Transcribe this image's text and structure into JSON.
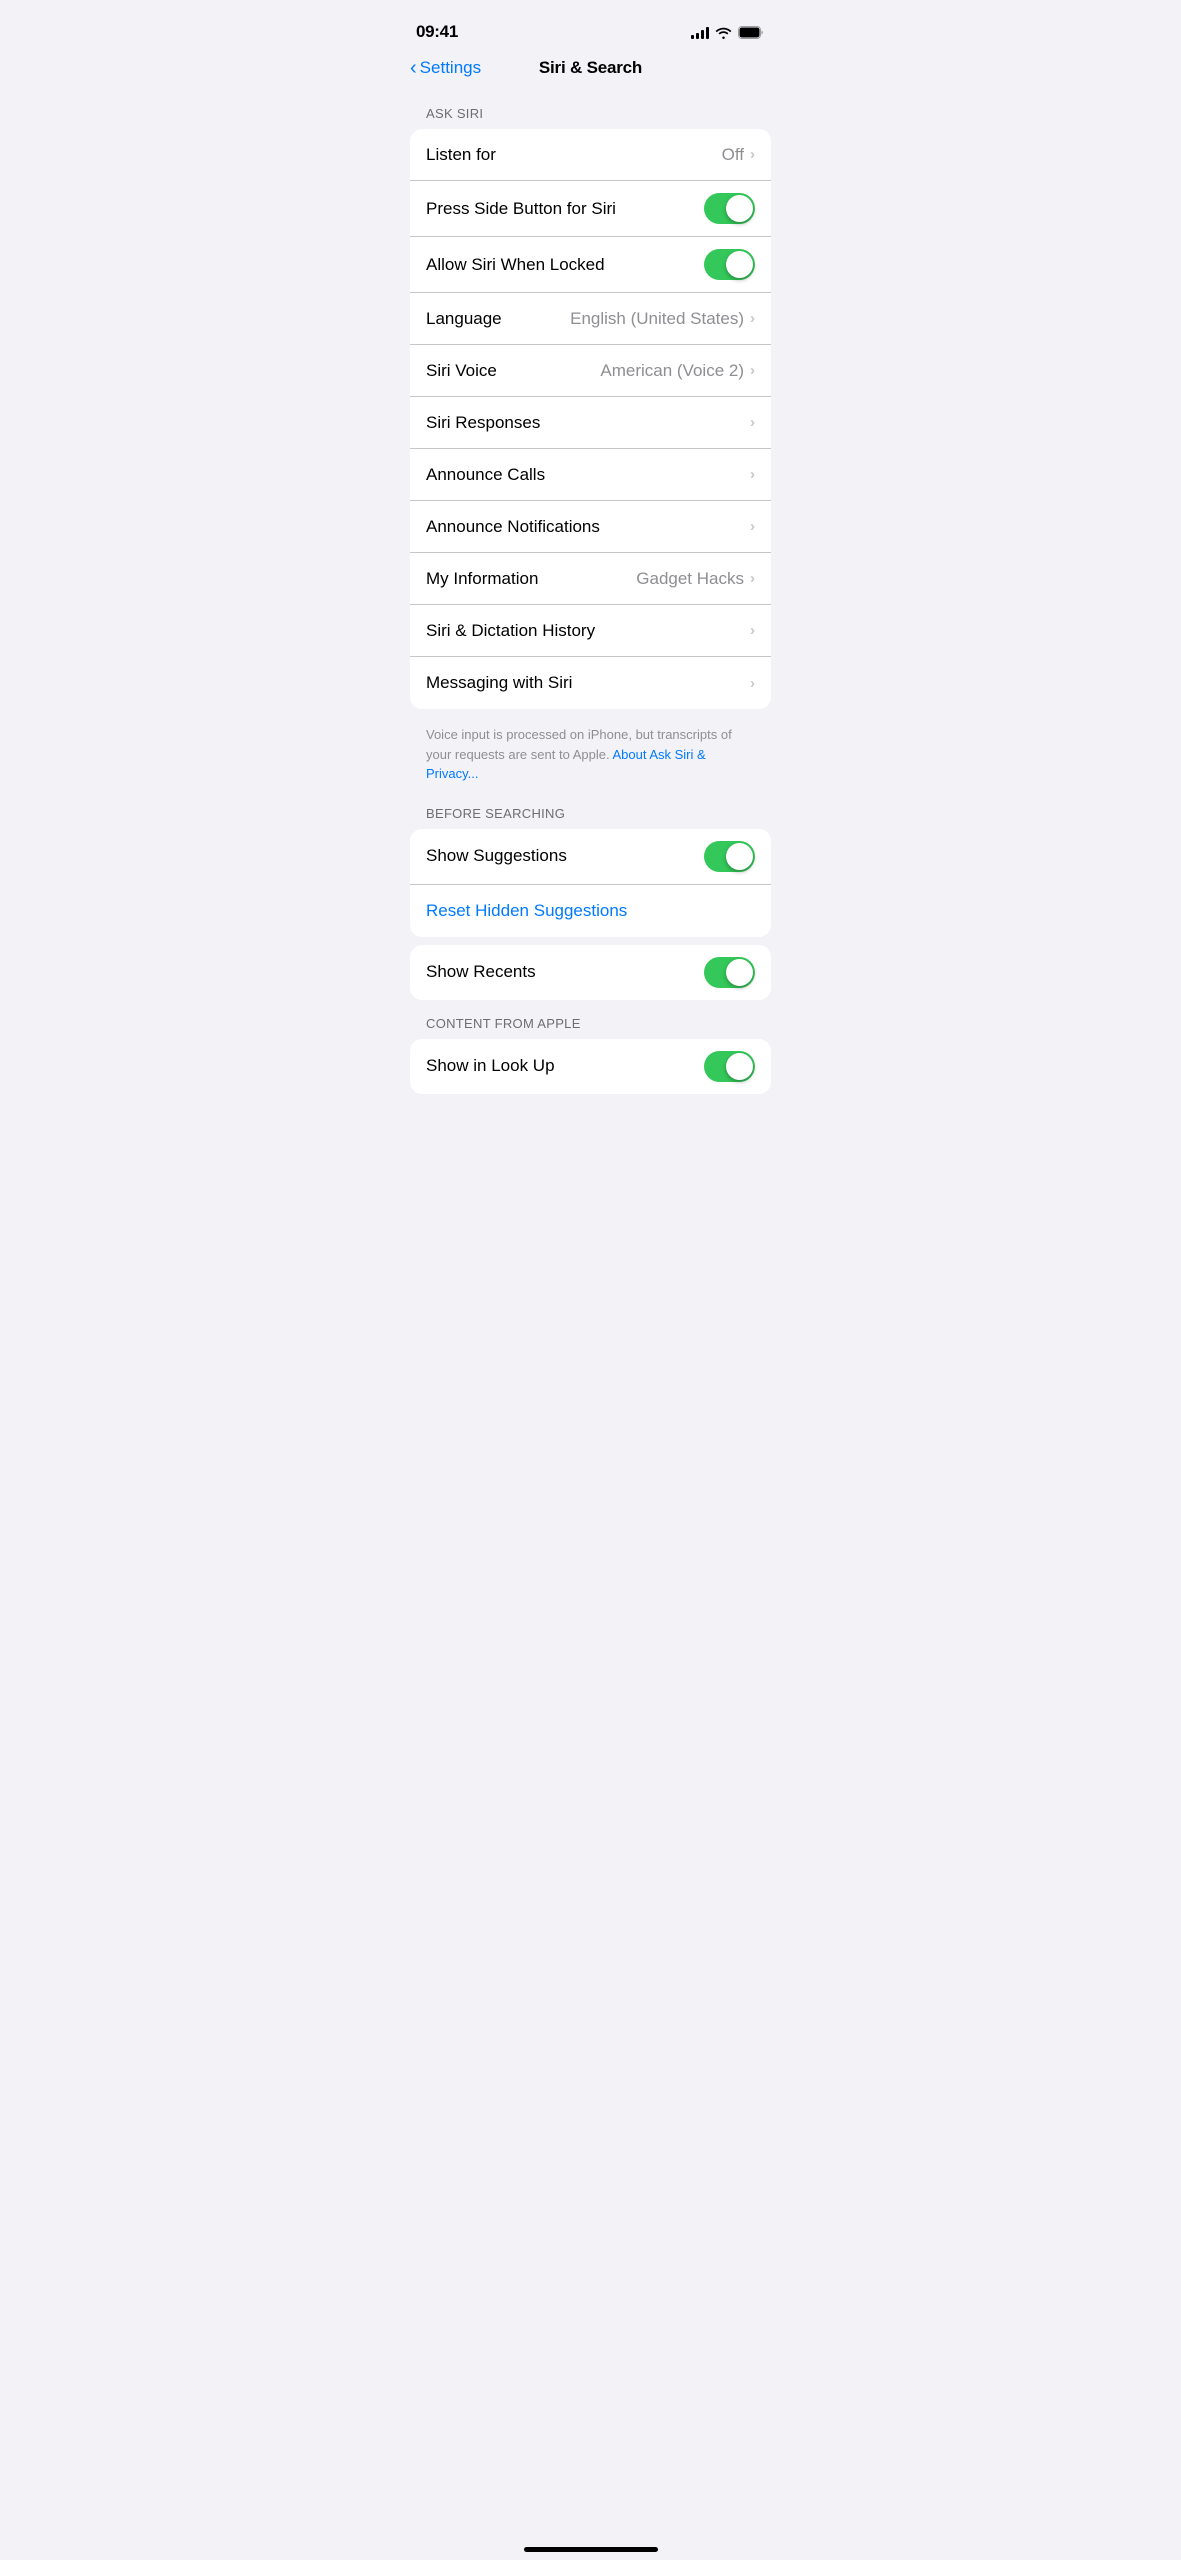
{
  "statusBar": {
    "time": "09:41",
    "signalBars": [
      4,
      6,
      8,
      10,
      12
    ],
    "batteryLevel": 100
  },
  "nav": {
    "backLabel": "Settings",
    "title": "Siri & Search"
  },
  "sections": {
    "askSiri": {
      "header": "ASK SIRI",
      "rows": [
        {
          "id": "listen-for",
          "label": "Listen for",
          "value": "Off",
          "type": "navigation"
        },
        {
          "id": "press-side-button",
          "label": "Press Side Button for Siri",
          "value": null,
          "type": "toggle",
          "enabled": true
        },
        {
          "id": "allow-when-locked",
          "label": "Allow Siri When Locked",
          "value": null,
          "type": "toggle",
          "enabled": true
        },
        {
          "id": "language",
          "label": "Language",
          "value": "English (United States)",
          "type": "navigation"
        },
        {
          "id": "siri-voice",
          "label": "Siri Voice",
          "value": "American (Voice 2)",
          "type": "navigation"
        },
        {
          "id": "siri-responses",
          "label": "Siri Responses",
          "value": null,
          "type": "navigation"
        },
        {
          "id": "announce-calls",
          "label": "Announce Calls",
          "value": null,
          "type": "navigation"
        },
        {
          "id": "announce-notifications",
          "label": "Announce Notifications",
          "value": null,
          "type": "navigation"
        },
        {
          "id": "my-information",
          "label": "My Information",
          "value": "Gadget Hacks",
          "type": "navigation"
        },
        {
          "id": "siri-dictation-history",
          "label": "Siri & Dictation History",
          "value": null,
          "type": "navigation"
        },
        {
          "id": "messaging-with-siri",
          "label": "Messaging with Siri",
          "value": null,
          "type": "navigation"
        }
      ],
      "footer": "Voice input is processed on iPhone, but transcripts of your requests are sent to Apple.",
      "footerLink": "About Ask Siri & Privacy..."
    },
    "beforeSearching": {
      "header": "BEFORE SEARCHING",
      "showSuggestions": {
        "label": "Show Suggestions",
        "enabled": true
      },
      "resetButton": "Reset Hidden Suggestions",
      "showRecents": {
        "label": "Show Recents",
        "enabled": true
      }
    },
    "contentFromApple": {
      "header": "CONTENT FROM APPLE",
      "showInLookUp": {
        "label": "Show in Look Up",
        "enabled": true
      }
    }
  }
}
